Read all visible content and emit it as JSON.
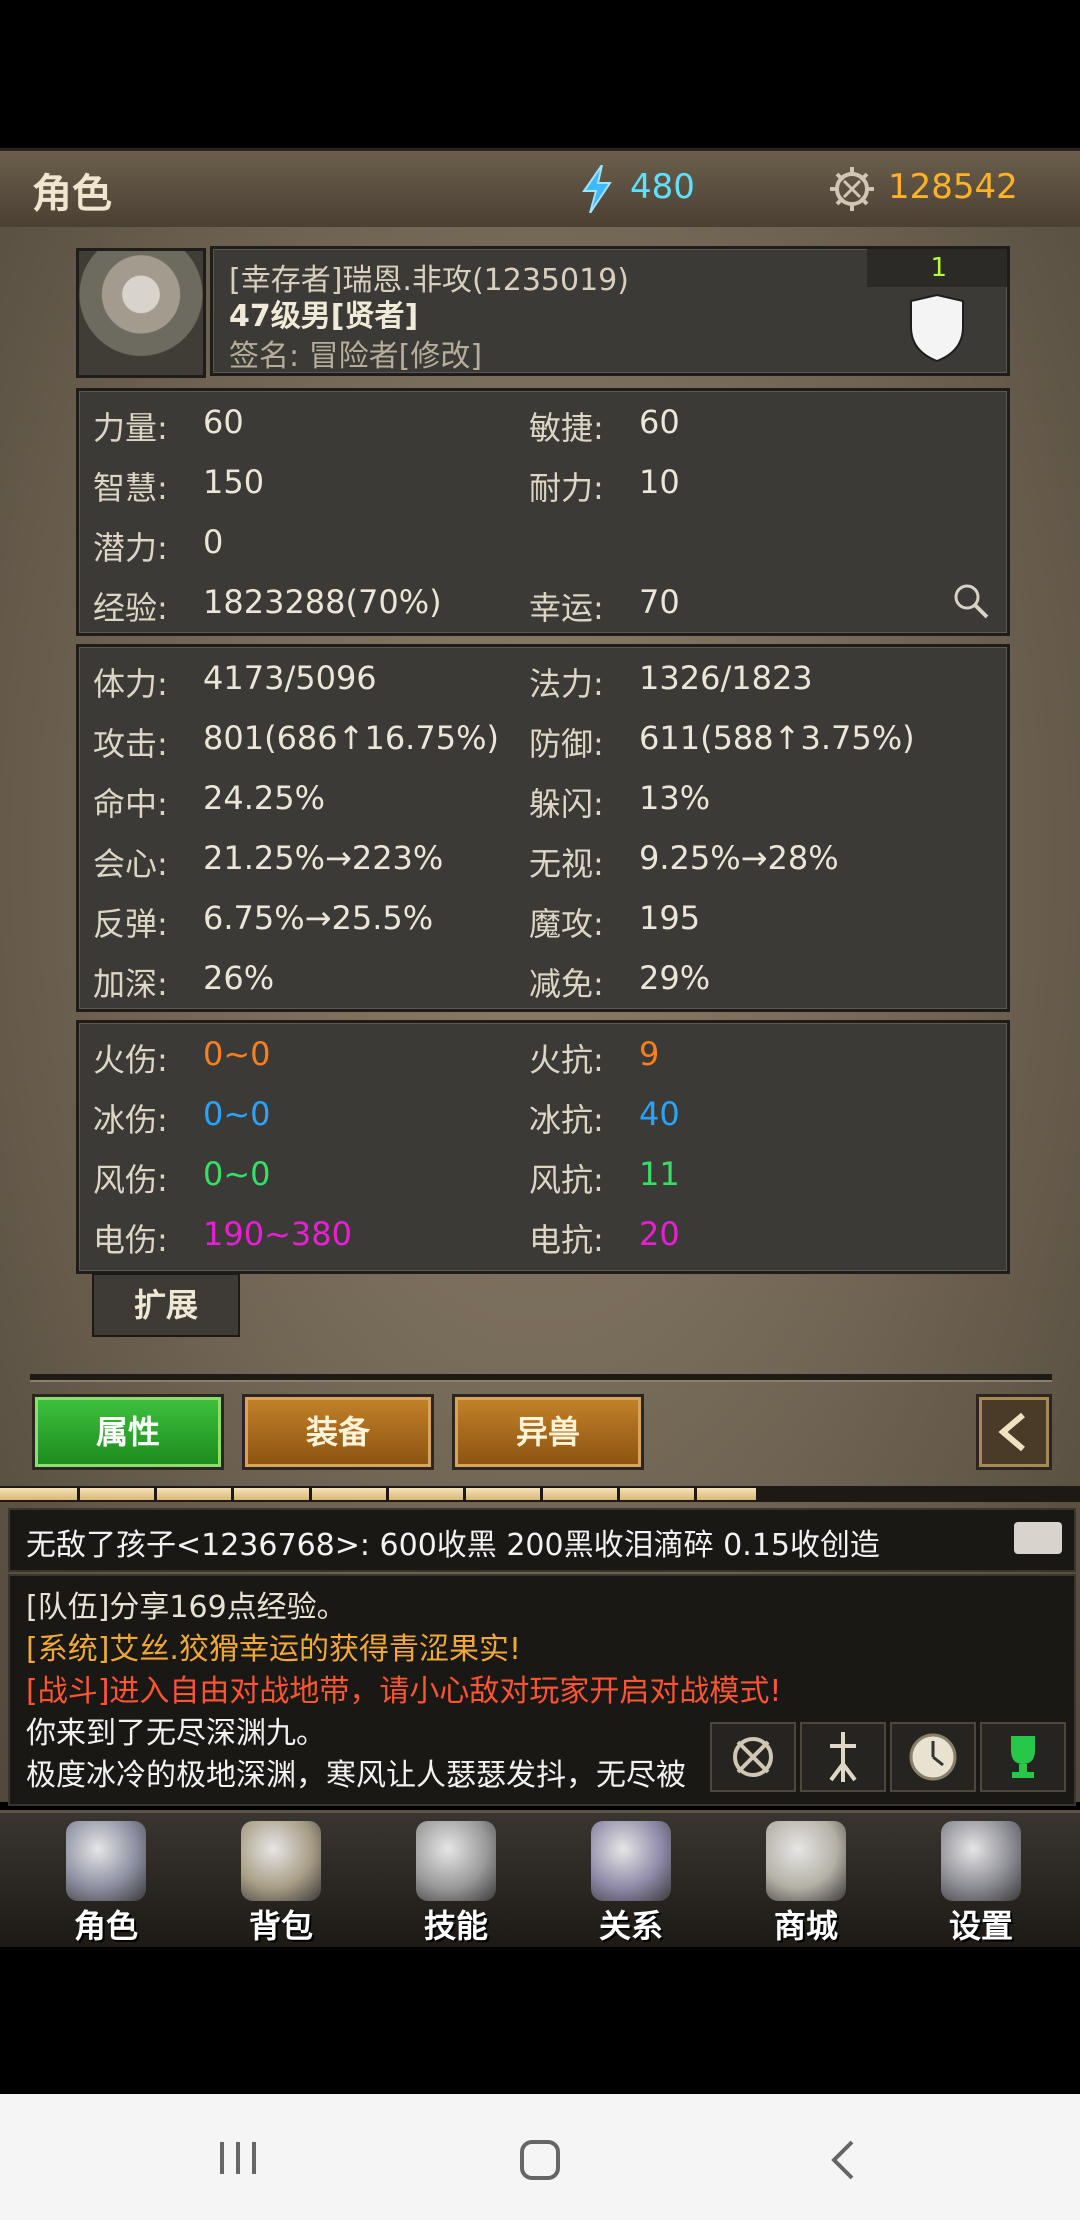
{
  "header": {
    "title": "角色",
    "energy": "480",
    "gold": "128542"
  },
  "profile": {
    "name": "[幸存者]瑞恩.非攻(1235019)",
    "level": "47级男[贤者]",
    "signature": "签名: 冒险者[修改]",
    "rank": "1"
  },
  "base_stats": [
    {
      "l1": "力量:",
      "v1": "60",
      "l2": "敏捷:",
      "v2": "60"
    },
    {
      "l1": "智慧:",
      "v1": "150",
      "l2": "耐力:",
      "v2": "10"
    },
    {
      "l1": "潜力:",
      "v1": "0",
      "l2": "",
      "v2": ""
    },
    {
      "l1": "经验:",
      "v1": "1823288(70%)",
      "l2": "幸运:",
      "v2": "70"
    }
  ],
  "combat_stats": [
    {
      "l1": "体力:",
      "v1": "4173/5096",
      "l2": "法力:",
      "v2": "1326/1823"
    },
    {
      "l1": "攻击:",
      "v1": "801(686↑16.75%)",
      "l2": "防御:",
      "v2": "611(588↑3.75%)"
    },
    {
      "l1": "命中:",
      "v1": "24.25%",
      "l2": "躲闪:",
      "v2": "13%"
    },
    {
      "l1": "会心:",
      "v1": "21.25%→223%",
      "l2": "无视:",
      "v2": "9.25%→28%"
    },
    {
      "l1": "反弹:",
      "v1": "6.75%→25.5%",
      "l2": "魔攻:",
      "v2": "195"
    },
    {
      "l1": "加深:",
      "v1": "26%",
      "l2": "减免:",
      "v2": "29%"
    }
  ],
  "element_stats": [
    {
      "l1": "火伤:",
      "v1": "0~0",
      "l2": "火抗:",
      "v2": "9",
      "color": "#ff7f1f"
    },
    {
      "l1": "冰伤:",
      "v1": "0~0",
      "l2": "冰抗:",
      "v2": "40",
      "color": "#2aa3ff"
    },
    {
      "l1": "风伤:",
      "v1": "0~0",
      "l2": "风抗:",
      "v2": "11",
      "color": "#34e068"
    },
    {
      "l1": "电伤:",
      "v1": "190~380",
      "l2": "电抗:",
      "v2": "20",
      "color": "#e81fd4"
    }
  ],
  "expand_label": "扩展",
  "tabs": {
    "attributes": "属性",
    "equipment": "装备",
    "beast": "异兽"
  },
  "progress": {
    "fraction": 0.7
  },
  "chat": {
    "message": "无敌了孩子<1236768>: 600收黑 200黑收泪滴碎 0.15收创造"
  },
  "log": [
    {
      "text": "[队伍]分享169点经验。",
      "color": "#e8e2d4"
    },
    {
      "text": "[系统]艾丝.狡猾幸运的获得青涩果实!",
      "color": "#f0a838"
    },
    {
      "text": "[战斗]进入自由对战地带，请小心敌对玩家开启对战模式!",
      "color": "#ff5533"
    },
    {
      "text": "你来到了无尽深渊九。",
      "color": "#f2f2f2"
    },
    {
      "text": "极度冰冷的极地深渊，寒风让人瑟瑟发抖，无尽被",
      "color": "#f2f2f2"
    }
  ],
  "nav": [
    {
      "label": "角色",
      "icon": "helmet-icon"
    },
    {
      "label": "背包",
      "icon": "backpack-icon"
    },
    {
      "label": "技能",
      "icon": "skill-book-icon"
    },
    {
      "label": "关系",
      "icon": "handshake-icon"
    },
    {
      "label": "商城",
      "icon": "chest-icon"
    },
    {
      "label": "设置",
      "icon": "gears-icon"
    }
  ]
}
